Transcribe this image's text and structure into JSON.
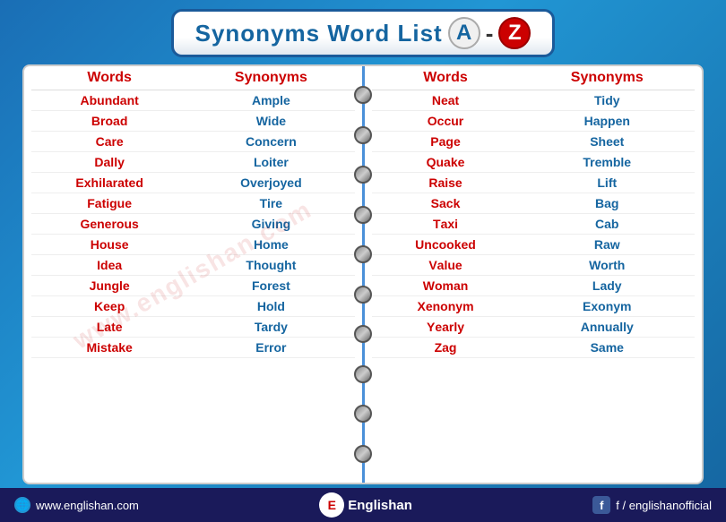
{
  "header": {
    "title": "Synonyms Word List",
    "letter_a": "A",
    "dash": "-",
    "letter_z": "Z"
  },
  "watermark": "www.englishan.com",
  "left_table": {
    "col1_header": "Words",
    "col2_header": "Synonyms",
    "rows": [
      {
        "word": "Abundant",
        "first": "A",
        "rest": "bundant",
        "synonym": "Ample"
      },
      {
        "word": "Broad",
        "first": "B",
        "rest": "road",
        "synonym": "Wide"
      },
      {
        "word": "Care",
        "first": "C",
        "rest": "are",
        "synonym": "Concern"
      },
      {
        "word": "Dally",
        "first": "D",
        "rest": "ally",
        "synonym": "Loiter"
      },
      {
        "word": "Exhilarated",
        "first": "E",
        "rest": "xhilarated",
        "synonym": "Overjoyed"
      },
      {
        "word": "Fatigue",
        "first": "F",
        "rest": "atigue",
        "synonym": "Tire"
      },
      {
        "word": "Generous",
        "first": "G",
        "rest": "enerous",
        "synonym": "Giving"
      },
      {
        "word": "House",
        "first": "H",
        "rest": "ouse",
        "synonym": "Home"
      },
      {
        "word": "Idea",
        "first": "I",
        "rest": "dea",
        "synonym": "Thought"
      },
      {
        "word": "Jungle",
        "first": "J",
        "rest": "ungle",
        "synonym": "Forest"
      },
      {
        "word": "Keep",
        "first": "K",
        "rest": "eep",
        "synonym": "Hold"
      },
      {
        "word": "Late",
        "first": "L",
        "rest": "ate",
        "synonym": "Tardy"
      },
      {
        "word": "Mistake",
        "first": "M",
        "rest": "istake",
        "synonym": "Error"
      }
    ]
  },
  "right_table": {
    "col1_header": "Words",
    "col2_header": "Synonyms",
    "rows": [
      {
        "word": "Neat",
        "first": "N",
        "rest": "eat",
        "synonym": "Tidy"
      },
      {
        "word": "Occur",
        "first": "O",
        "rest": "ccur",
        "synonym": "Happen"
      },
      {
        "word": "Page",
        "first": "P",
        "rest": "age",
        "synonym": "Sheet"
      },
      {
        "word": "Quake",
        "first": "Q",
        "rest": "uake",
        "synonym": "Tremble"
      },
      {
        "word": "Raise",
        "first": "R",
        "rest": "aise",
        "synonym": "Lift"
      },
      {
        "word": "Sack",
        "first": "S",
        "rest": "ack",
        "synonym": "Bag"
      },
      {
        "word": "Taxi",
        "first": "T",
        "rest": "axi",
        "synonym": "Cab"
      },
      {
        "word": "Uncooked",
        "first": "U",
        "rest": "ncooked",
        "synonym": "Raw"
      },
      {
        "word": "Value",
        "first": "V",
        "rest": "alue",
        "synonym": "Worth"
      },
      {
        "word": "Woman",
        "first": "W",
        "rest": "oman",
        "synonym": "Lady"
      },
      {
        "word": "Xenonym",
        "first": "X",
        "rest": "enonym",
        "synonym": "Exonym"
      },
      {
        "word": "Yearly",
        "first": "Y",
        "rest": "early",
        "synonym": "Annually"
      },
      {
        "word": "Zag",
        "first": "Z",
        "rest": "ag",
        "synonym": "Same"
      }
    ]
  },
  "footer": {
    "website": "www.englishan.com",
    "logo_text": "Englishan",
    "facebook": "f / englishanofficial"
  },
  "spiral": {
    "ring_count": 10
  }
}
